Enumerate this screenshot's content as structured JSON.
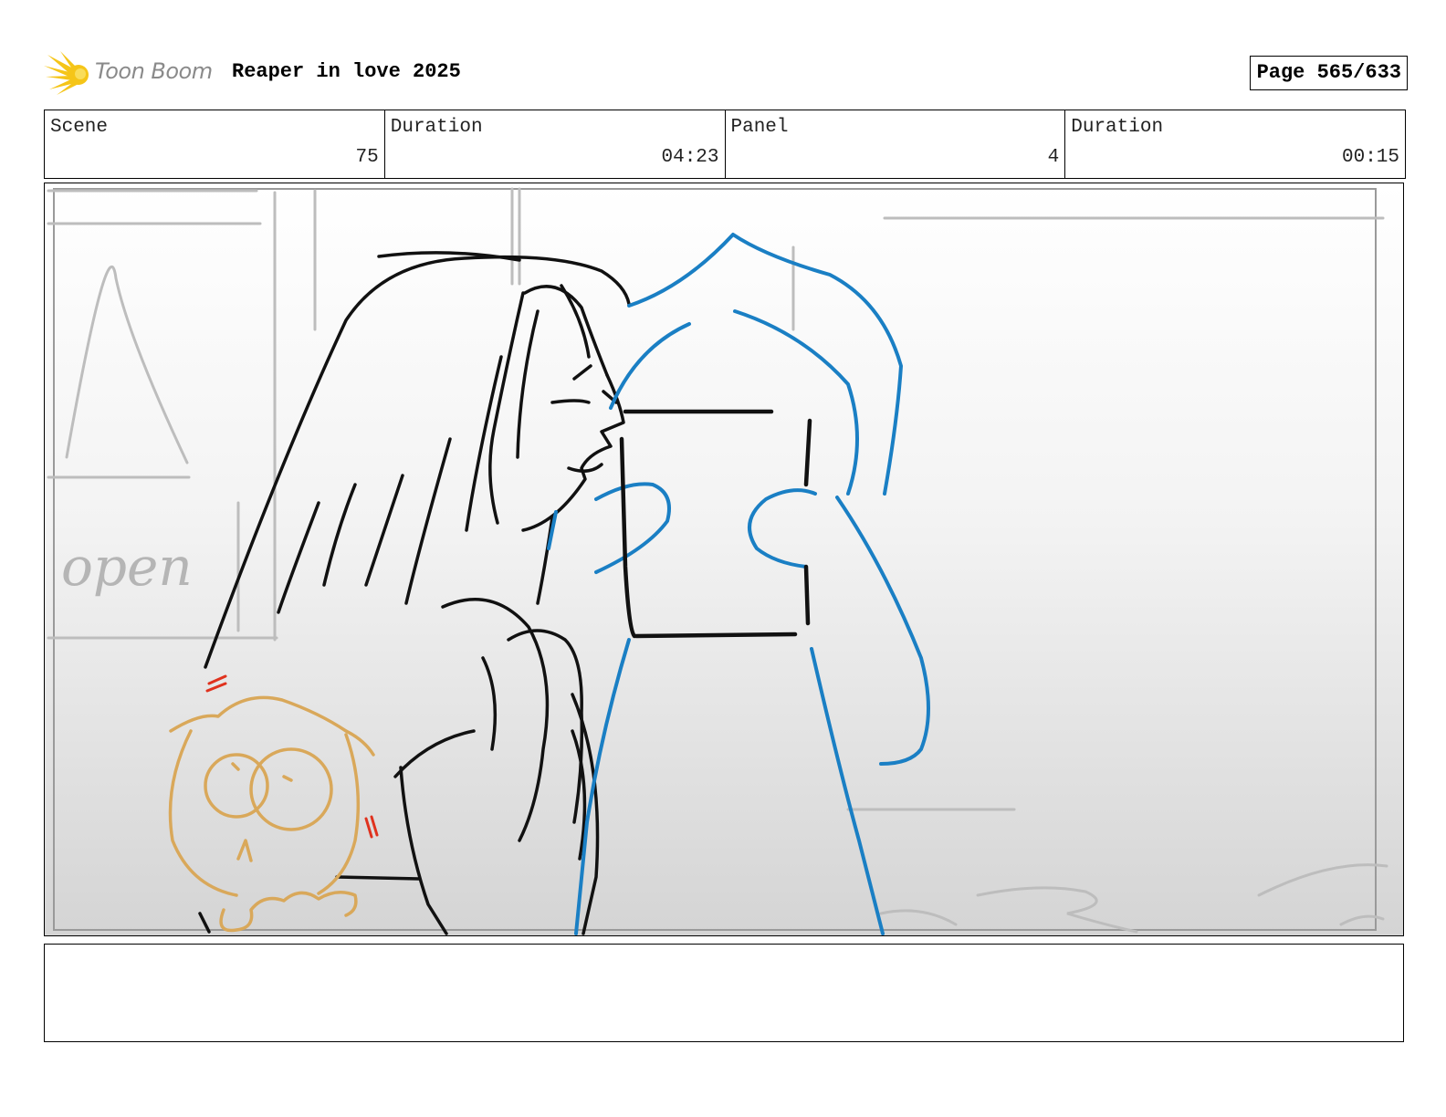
{
  "header": {
    "logo_text": "Toon Boom",
    "project_title": "Reaper in love 2025",
    "page": "Page 565/633"
  },
  "info": {
    "scene_label": "Scene",
    "scene_value": "75",
    "scene_duration_label": "Duration",
    "scene_duration_value": "04:23",
    "panel_label": "Panel",
    "panel_value": "4",
    "panel_duration_label": "Duration",
    "panel_duration_value": "00:15"
  },
  "panel": {
    "sign_text": "open"
  },
  "notes": {
    "text": ""
  },
  "colors": {
    "logo_yellow": "#f5c518",
    "character_blue": "#1a7fc4",
    "creature_gold": "#d9a85a",
    "accent_red": "#e0321e"
  }
}
